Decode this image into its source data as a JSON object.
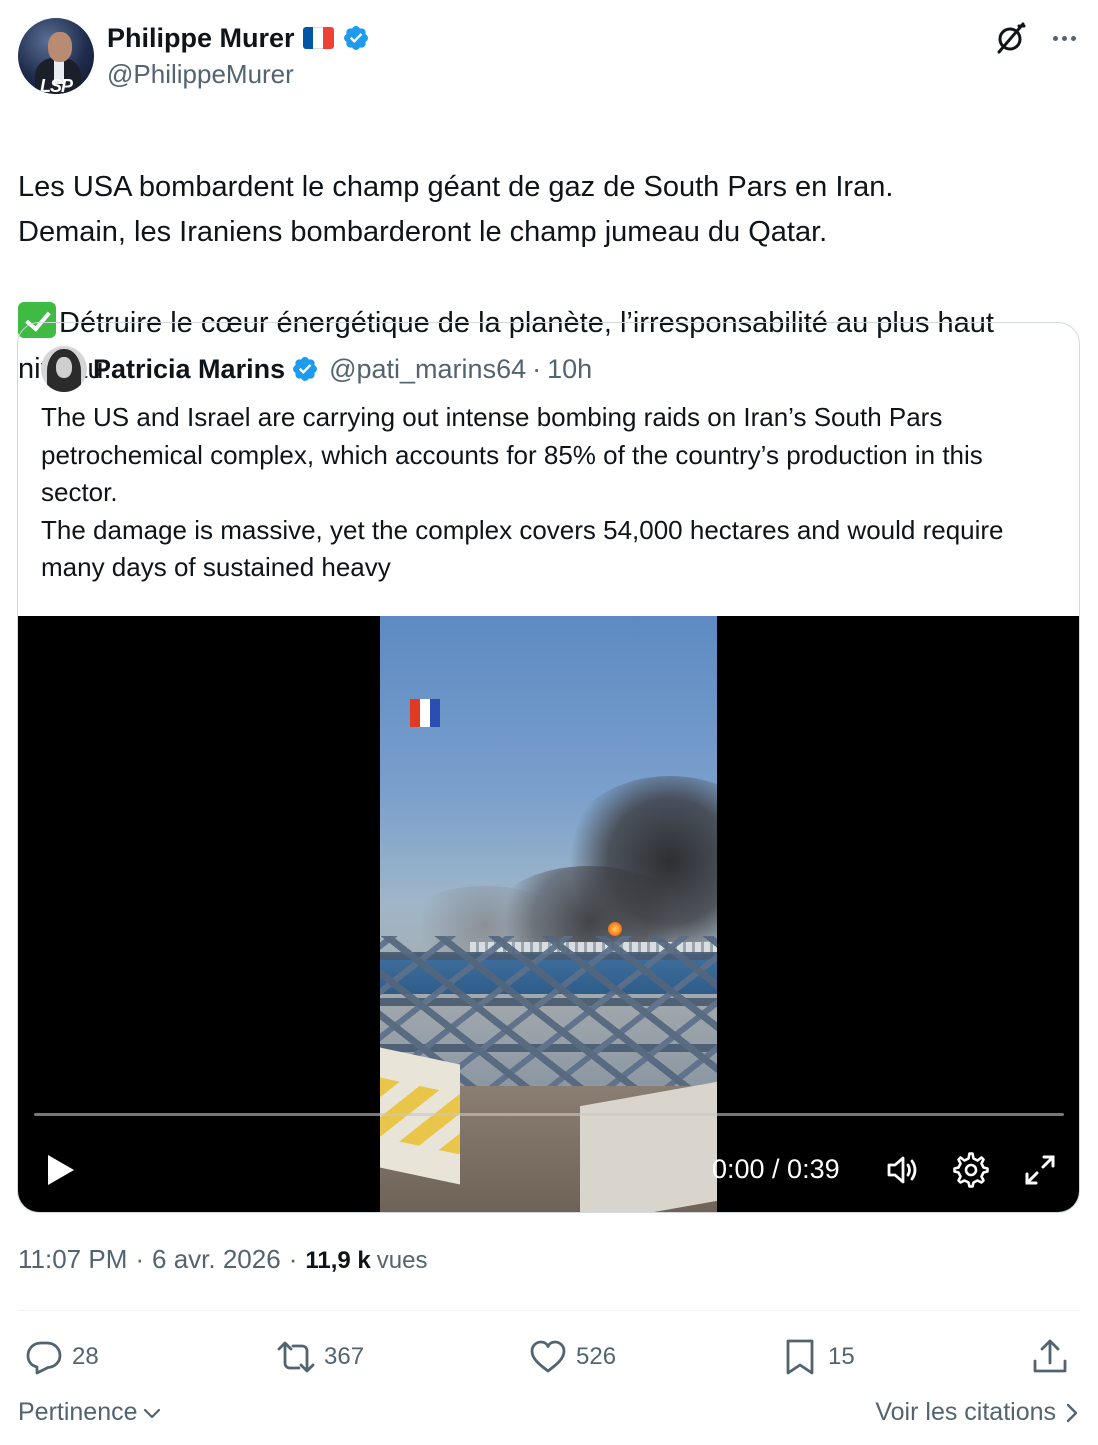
{
  "author": {
    "name": "Philippe Murer",
    "handle": "@PhilippeMurer",
    "flag_colors": [
      "#0055a4",
      "#ffffff",
      "#ef4135"
    ],
    "verified_color": "#1d9bf0",
    "avatar_badge": "LSP"
  },
  "post": {
    "text": "Les USA bombardent le champ géant de gaz de South Pars en Iran.\nDemain, les Iraniens bombarderont le champ jumeau du Qatar.",
    "line3": "Détruire le cœur énergétique de la planète, l’irresponsabilité au plus haut niveau.",
    "check_emoji": "check-mark-button"
  },
  "quote": {
    "name": "Patricia Marins",
    "handle": "@pati_marins64",
    "separator": "·",
    "age": "10h",
    "text": "The US and Israel are carrying out intense bombing raids on Iran’s South Pars petrochemical complex, which accounts for 85% of the country’s production in this sector.\nThe damage is massive, yet the complex covers 54,000 hectares and would require many days of sustained heavy",
    "video": {
      "current_time": "0:00",
      "duration": "0:39",
      "time_display": "0:00 / 0:39",
      "progress": 0
    }
  },
  "meta": {
    "time": "11:07 PM",
    "sep": "·",
    "date": "6 avr. 2026",
    "sep2": "·",
    "views_count": "11,9 k",
    "views_label": "vues"
  },
  "actions": {
    "replies": "28",
    "reposts": "367",
    "likes": "526",
    "bookmarks": "15"
  },
  "footer": {
    "sort_label": "Pertinence",
    "quotes_link": "Voir les citations"
  },
  "colors": {
    "text_primary": "#0f1419",
    "text_secondary": "#536471",
    "border": "#cfd9de",
    "check_green": "#3fbb43"
  }
}
